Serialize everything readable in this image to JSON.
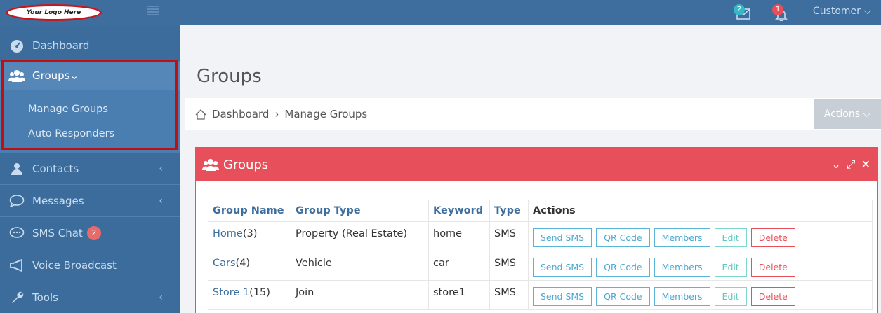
{
  "topbar": {
    "logo_text": "Your Logo Here",
    "messages_badge": "2",
    "notifications_badge": "1",
    "user_label": "Customer ⌵",
    "colors": {
      "bar": "#3d6e9e",
      "messages_badge": "#36b8c9",
      "notifications_badge": "#e7505a"
    }
  },
  "sidebar": {
    "items": [
      {
        "label": "Dashboard",
        "icon": "dashboard-icon"
      },
      {
        "label": "Groups",
        "icon": "users-icon"
      },
      {
        "label": "Contacts",
        "icon": "user-icon"
      },
      {
        "label": "Messages",
        "icon": "chat-bubble-icon"
      },
      {
        "label": "SMS Chat",
        "icon": "sms-chat-icon",
        "badge": "2"
      },
      {
        "label": "Voice Broadcast",
        "icon": "megaphone-icon"
      },
      {
        "label": "Tools",
        "icon": "wrench-icon"
      }
    ],
    "groups_submenu": [
      "Manage Groups",
      "Auto Responders"
    ]
  },
  "main": {
    "page_title": "Groups",
    "breadcrumb": {
      "home": "Dashboard",
      "separator": "›",
      "current": "Manage Groups"
    },
    "actions_label": "Actions ⌵",
    "panel": {
      "title": "Groups",
      "color": "#e7505a",
      "columns": [
        "Group Name",
        "Group Type",
        "Keyword",
        "Type",
        "Actions"
      ],
      "rows": [
        {
          "name": "Home",
          "count": "(3)",
          "group_type": "Property (Real Estate)",
          "keyword": "home",
          "type": "SMS"
        },
        {
          "name": "Cars",
          "count": "(4)",
          "group_type": "Vehicle",
          "keyword": "car",
          "type": "SMS"
        },
        {
          "name": "Store 1",
          "count": "(15)",
          "group_type": "Join",
          "keyword": "store1",
          "type": "SMS"
        }
      ],
      "row_buttons": {
        "send_sms": "Send SMS",
        "qr_code": "QR Code",
        "members": "Members",
        "edit": "Edit",
        "delete": "Delete"
      }
    }
  }
}
